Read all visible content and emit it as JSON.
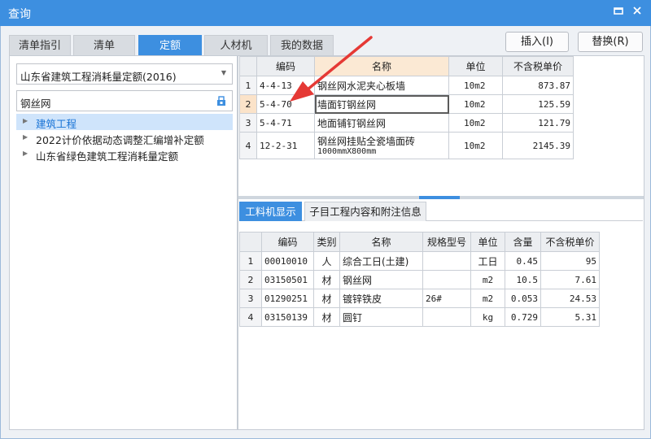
{
  "window": {
    "title": "查询",
    "pin_icon": "pin-icon",
    "close_icon": "close-icon"
  },
  "tabs": [
    {
      "label": "清单指引",
      "active": false
    },
    {
      "label": "清单",
      "active": false
    },
    {
      "label": "定额",
      "active": true
    },
    {
      "label": "人材机",
      "active": false
    },
    {
      "label": "我的数据",
      "active": false
    }
  ],
  "buttons": {
    "insert": "插入(I)",
    "replace": "替换(R)"
  },
  "left": {
    "quota_library": "山东省建筑工程消耗量定额(2016)",
    "search_value": "钢丝网",
    "tree": [
      {
        "label": "建筑工程",
        "selected": true
      },
      {
        "label": "2022计价依据动态调整汇编增补定额",
        "selected": false
      },
      {
        "label": "山东省绿色建筑工程消耗量定额",
        "selected": false
      }
    ]
  },
  "quota_table": {
    "headers": [
      "",
      "编码",
      "名称",
      "单位",
      "不含税单价"
    ],
    "rows": [
      {
        "n": "1",
        "code": "4-4-13",
        "name": "钢丝网水泥夹心板墙",
        "name2": "",
        "unit": "10m2",
        "price": "873.87"
      },
      {
        "n": "2",
        "code": "5-4-70",
        "name": "墙面钉钢丝网",
        "name2": "",
        "unit": "10m2",
        "price": "125.59"
      },
      {
        "n": "3",
        "code": "5-4-71",
        "name": "地面铺钉钢丝网",
        "name2": "",
        "unit": "10m2",
        "price": "121.79"
      },
      {
        "n": "4",
        "code": "12-2-31",
        "name": "钢丝网挂贴全瓷墙面砖",
        "name2": "1000mmX800mm",
        "unit": "10m2",
        "price": "2145.39"
      }
    ]
  },
  "subtabs": [
    {
      "label": "工料机显示",
      "active": true
    },
    {
      "label": "子目工程内容和附注信息",
      "active": false
    }
  ],
  "resource_table": {
    "headers": [
      "",
      "编码",
      "类别",
      "名称",
      "规格型号",
      "单位",
      "含量",
      "不含税单价"
    ],
    "rows": [
      {
        "n": "1",
        "code": "00010010",
        "type": "人",
        "name": "综合工日(土建)",
        "spec": "",
        "unit": "工日",
        "qty": "0.45",
        "price": "95"
      },
      {
        "n": "2",
        "code": "03150501",
        "type": "材",
        "name": "钢丝网",
        "spec": "",
        "unit": "m2",
        "qty": "10.5",
        "price": "7.61"
      },
      {
        "n": "3",
        "code": "01290251",
        "type": "材",
        "name": "镀锌铁皮",
        "spec": "26#",
        "unit": "m2",
        "qty": "0.053",
        "price": "24.53"
      },
      {
        "n": "4",
        "code": "03150139",
        "type": "材",
        "name": "圆钉",
        "spec": "",
        "unit": "kg",
        "qty": "0.729",
        "price": "5.31"
      }
    ]
  },
  "annotation_color": "#e53935"
}
